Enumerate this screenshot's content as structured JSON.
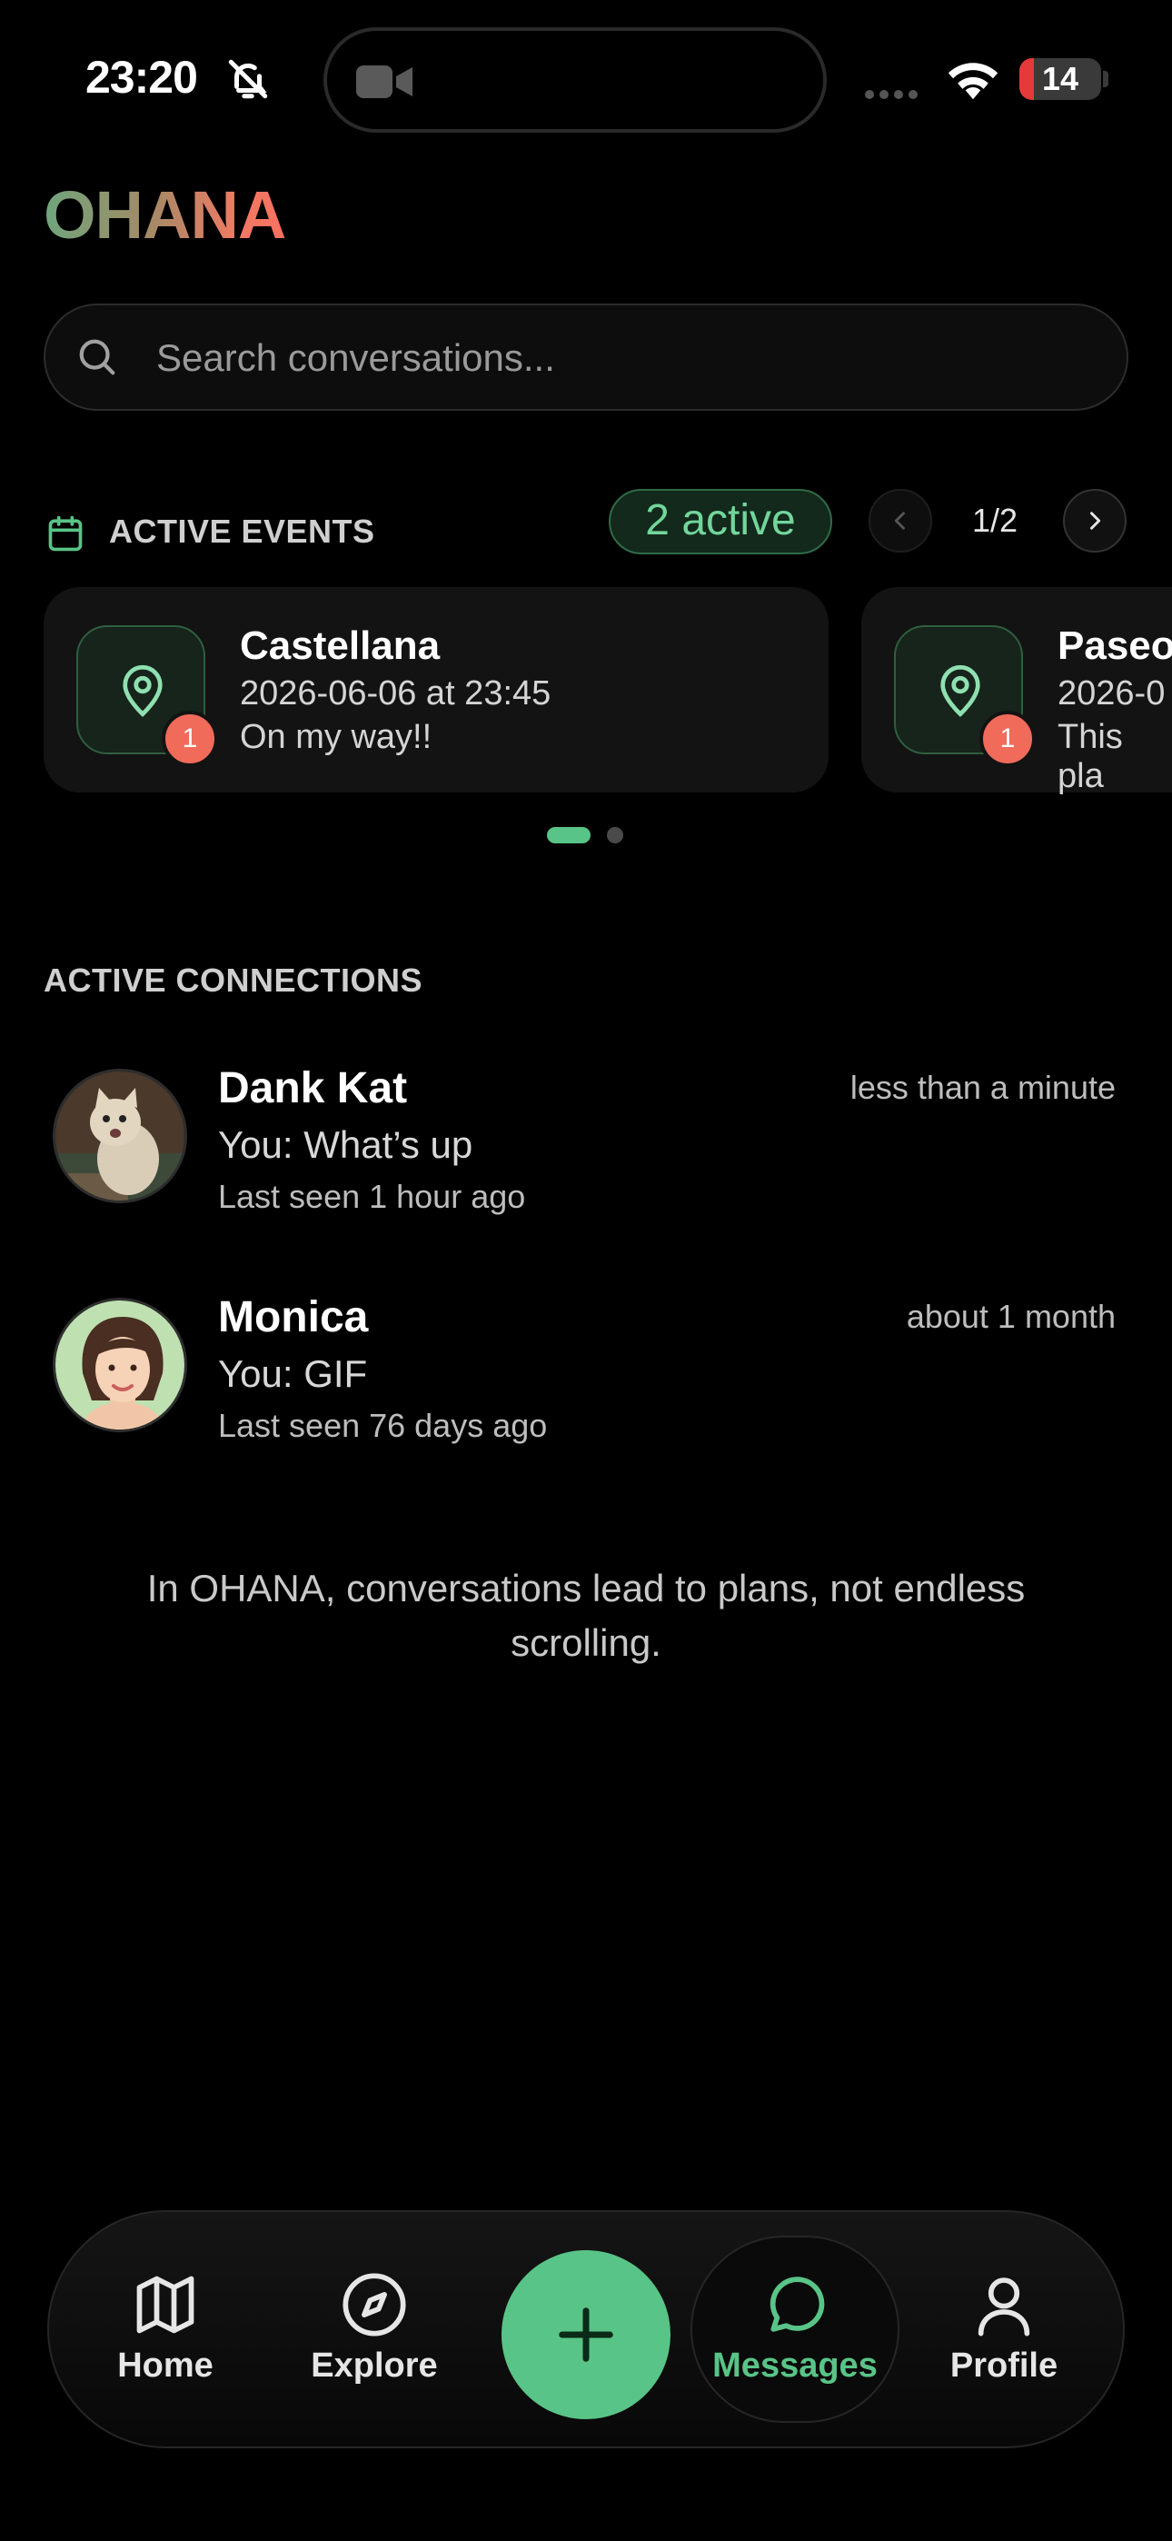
{
  "status_bar": {
    "time": "23:20",
    "battery": "14",
    "icons": [
      "bell-slash-icon",
      "video-camera-icon",
      "wifi-icon",
      "battery-icon"
    ]
  },
  "app": {
    "title": "OHANA"
  },
  "search": {
    "placeholder": "Search conversations..."
  },
  "events": {
    "title": "ACTIVE EVENTS",
    "active_count": "2 active",
    "page": "1/2",
    "cards": [
      {
        "name": "Castellana",
        "date": "2026-06-06 at 23:45",
        "message": "On my way!!",
        "badge": "1"
      },
      {
        "name": "Paseo",
        "date": "2026-0",
        "message": "This pla",
        "badge": "1"
      }
    ]
  },
  "connections": {
    "title": "ACTIVE CONNECTIONS",
    "items": [
      {
        "name": "Dank Kat",
        "message": "You: What’s up",
        "last_seen": "Last seen 1 hour ago",
        "time": "less than a minute"
      },
      {
        "name": "Monica",
        "message": "You: GIF",
        "last_seen": "Last seen 76 days ago",
        "time": "about 1 month"
      }
    ]
  },
  "tagline": "In OHANA, conversations lead to plans, not endless scrolling.",
  "nav": {
    "home": "Home",
    "explore": "Explore",
    "messages": "Messages",
    "profile": "Profile"
  },
  "colors": {
    "accent": "#59c487",
    "badge": "#f06b5a",
    "background": "#000000"
  }
}
